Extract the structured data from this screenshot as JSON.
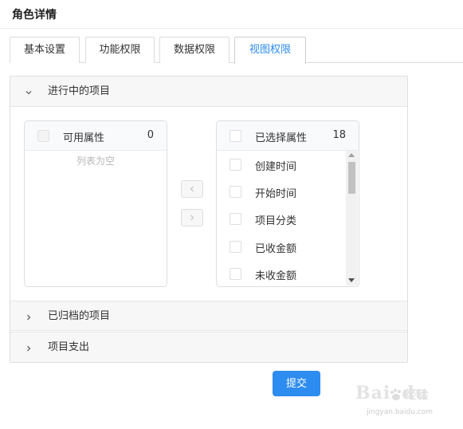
{
  "page": {
    "title": "角色详情"
  },
  "tabs": [
    {
      "label": "基本设置",
      "active": false
    },
    {
      "label": "功能权限",
      "active": false
    },
    {
      "label": "数据权限",
      "active": false
    },
    {
      "label": "视图权限",
      "active": true
    }
  ],
  "panels": [
    {
      "label": "进行中的项目",
      "expanded": true,
      "icon": "chevron-down-icon"
    },
    {
      "label": "已归档的项目",
      "expanded": false,
      "icon": "chevron-right-icon"
    },
    {
      "label": "项目支出",
      "expanded": false,
      "icon": "chevron-right-icon"
    }
  ],
  "transfer": {
    "available": {
      "title": "可用属性",
      "count": "0",
      "empty_text": "列表为空"
    },
    "selected": {
      "title": "已选择属性",
      "count": "18",
      "items": [
        "创建时间",
        "开始时间",
        "项目分类",
        "已收金额",
        "未收金额"
      ]
    },
    "move_left_icon": "chevron-left-icon",
    "move_right_icon": "chevron-right-icon"
  },
  "actions": {
    "submit_label": "提交"
  },
  "watermark": {
    "text": "Bai",
    "text2": "du",
    "cn": "经验",
    "url": "jingyan.baidu.com"
  },
  "colors": {
    "accent": "#2d8cf0",
    "header_bg": "#f7f7f7",
    "border": "#dcdee2"
  }
}
